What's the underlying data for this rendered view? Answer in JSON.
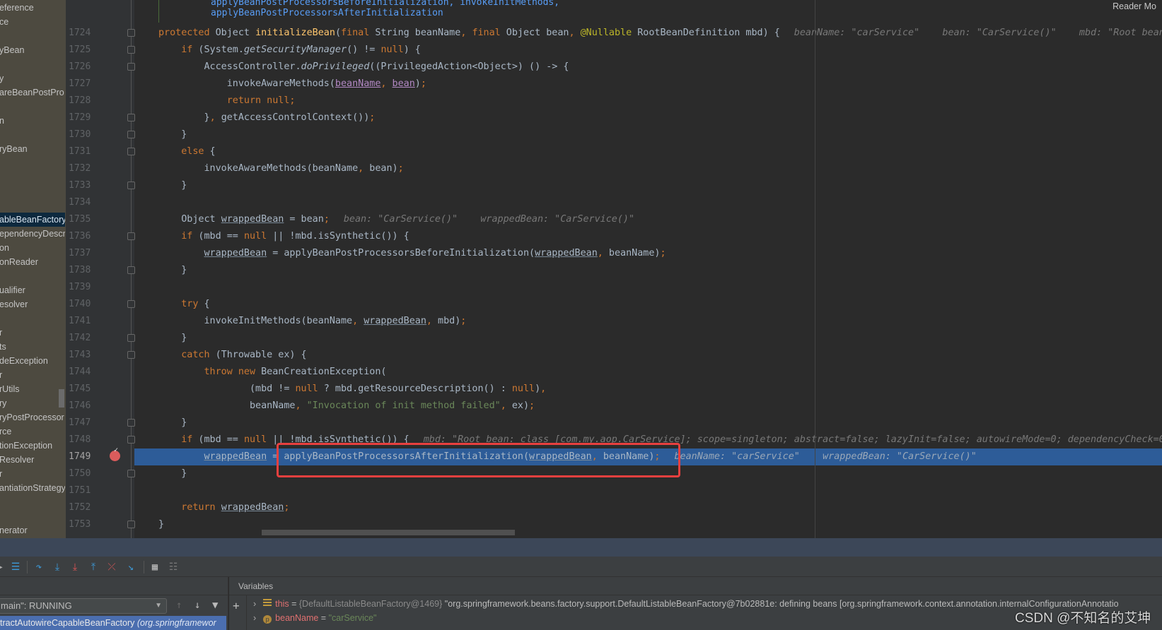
{
  "editor": {
    "reader_mode": "Reader Mo",
    "doc_lines": [
      "applyBeanPostProcessorsBeforeInitialization, invokeInitMethods,",
      "applyBeanPostProcessorsAfterInitialization"
    ],
    "current_line": 1749,
    "breakpoint_line": 1749,
    "lines": [
      {
        "n": 1724,
        "t": [
          [
            "protected",
            "k"
          ],
          [
            " Object ",
            "d"
          ],
          [
            "initializeBean",
            "m"
          ],
          [
            "(",
            "d"
          ],
          [
            "final",
            "k"
          ],
          [
            " String beanName",
            "d"
          ],
          [
            ", ",
            "k"
          ],
          [
            "final",
            "k"
          ],
          [
            " Object bean",
            "d"
          ],
          [
            ", ",
            "k"
          ],
          [
            "@Nullable",
            "a"
          ],
          [
            " RootBeanDefinition mbd) {",
            "d"
          ]
        ],
        "hint": "beanName: \"carService\"    bean: \"CarService()\"    mbd: \"Root bean: "
      },
      {
        "n": 1725,
        "t": [
          [
            "    if",
            "k"
          ],
          [
            " (System.",
            "d"
          ],
          [
            "getSecurityManager",
            "i"
          ],
          [
            "() != ",
            "d"
          ],
          [
            "null",
            "k"
          ],
          [
            ") {",
            "d"
          ]
        ]
      },
      {
        "n": 1726,
        "t": [
          [
            "        AccessController.",
            "d"
          ],
          [
            "doPrivileged",
            "i"
          ],
          [
            "((PrivilegedAction<Object>) () -> {",
            "d"
          ]
        ]
      },
      {
        "n": 1727,
        "t": [
          [
            "            invokeAwareMethods(",
            "d"
          ],
          [
            "beanName",
            "p"
          ],
          [
            ", ",
            "k"
          ],
          [
            "bean",
            "p"
          ],
          [
            ")",
            "d"
          ],
          [
            ";",
            "k"
          ]
        ]
      },
      {
        "n": 1728,
        "t": [
          [
            "            return null;",
            "k"
          ]
        ]
      },
      {
        "n": 1729,
        "t": [
          [
            "        }",
            "d"
          ],
          [
            ", ",
            "k"
          ],
          [
            "getAccessControlContext())",
            "d"
          ],
          [
            ";",
            "k"
          ]
        ]
      },
      {
        "n": 1730,
        "t": [
          [
            "    }",
            "d"
          ]
        ]
      },
      {
        "n": 1731,
        "t": [
          [
            "    else",
            "k"
          ],
          [
            " {",
            "d"
          ]
        ]
      },
      {
        "n": 1732,
        "t": [
          [
            "        invokeAwareMethods(beanName",
            "d"
          ],
          [
            ", ",
            "k"
          ],
          [
            "bean)",
            "d"
          ],
          [
            ";",
            "k"
          ]
        ]
      },
      {
        "n": 1733,
        "t": [
          [
            "    }",
            "d"
          ]
        ]
      },
      {
        "n": 1734,
        "t": []
      },
      {
        "n": 1735,
        "t": [
          [
            "    Object ",
            "d"
          ],
          [
            "wrappedBean",
            "u"
          ],
          [
            " = bean",
            "d"
          ],
          [
            ";",
            "k"
          ]
        ],
        "hint": "bean: \"CarService()\"    wrappedBean: \"CarService()\""
      },
      {
        "n": 1736,
        "t": [
          [
            "    if",
            "k"
          ],
          [
            " (mbd == ",
            "d"
          ],
          [
            "null",
            "k"
          ],
          [
            " || !mbd.isSynthetic()) {",
            "d"
          ]
        ]
      },
      {
        "n": 1737,
        "t": [
          [
            "        ",
            "d"
          ],
          [
            "wrappedBean",
            "u"
          ],
          [
            " = applyBeanPostProcessorsBeforeInitialization(",
            "d"
          ],
          [
            "wrappedBean",
            "u"
          ],
          [
            ", ",
            "k"
          ],
          [
            "beanName)",
            "d"
          ],
          [
            ";",
            "k"
          ]
        ]
      },
      {
        "n": 1738,
        "t": [
          [
            "    }",
            "d"
          ]
        ]
      },
      {
        "n": 1739,
        "t": []
      },
      {
        "n": 1740,
        "t": [
          [
            "    try",
            "k"
          ],
          [
            " {",
            "d"
          ]
        ]
      },
      {
        "n": 1741,
        "t": [
          [
            "        invokeInitMethods(beanName",
            "d"
          ],
          [
            ", ",
            "k"
          ],
          [
            "wrappedBean",
            "u"
          ],
          [
            ", ",
            "k"
          ],
          [
            "mbd)",
            "d"
          ],
          [
            ";",
            "k"
          ]
        ]
      },
      {
        "n": 1742,
        "t": [
          [
            "    }",
            "d"
          ]
        ]
      },
      {
        "n": 1743,
        "t": [
          [
            "    catch",
            "k"
          ],
          [
            " (Throwable ex) {",
            "d"
          ]
        ]
      },
      {
        "n": 1744,
        "t": [
          [
            "        throw new",
            "k"
          ],
          [
            " BeanCreationException(",
            "d"
          ]
        ]
      },
      {
        "n": 1745,
        "t": [
          [
            "                (mbd != ",
            "d"
          ],
          [
            "null",
            "k"
          ],
          [
            " ? mbd.getResourceDescription() : ",
            "d"
          ],
          [
            "null",
            "k"
          ],
          [
            ")",
            "d"
          ],
          [
            ",",
            "k"
          ]
        ]
      },
      {
        "n": 1746,
        "t": [
          [
            "                beanName",
            "d"
          ],
          [
            ", ",
            "k"
          ],
          [
            "\"Invocation of init method failed\"",
            "s"
          ],
          [
            ", ",
            "k"
          ],
          [
            "ex)",
            "d"
          ],
          [
            ";",
            "k"
          ]
        ]
      },
      {
        "n": 1747,
        "t": [
          [
            "    }",
            "d"
          ]
        ]
      },
      {
        "n": 1748,
        "t": [
          [
            "    if",
            "k"
          ],
          [
            " (mbd == ",
            "d"
          ],
          [
            "null",
            "k"
          ],
          [
            " || !mbd.isSynthetic()) {",
            "d"
          ]
        ],
        "hint": "mbd: \"Root bean: class [com.my.aop.CarService]; scope=singleton; abstract=false; lazyInit=false; autowireMode=0; dependencyCheck=0;"
      },
      {
        "n": 1749,
        "t": [
          [
            "        ",
            "d"
          ],
          [
            "wrappedBean",
            "u"
          ],
          [
            " = applyBeanPostProcessorsAfterInitialization(",
            "d"
          ],
          [
            "wrappedBean",
            "u"
          ],
          [
            ", ",
            "k"
          ],
          [
            "beanName)",
            "d"
          ],
          [
            ";",
            "k"
          ]
        ],
        "hint": "beanName: \"carService\"    wrappedBean: \"CarService()\""
      },
      {
        "n": 1750,
        "t": [
          [
            "    }",
            "d"
          ]
        ]
      },
      {
        "n": 1751,
        "t": []
      },
      {
        "n": 1752,
        "t": [
          [
            "    return",
            "k"
          ],
          [
            " ",
            "d"
          ],
          [
            "wrappedBean",
            "u"
          ],
          [
            ";",
            "k"
          ]
        ]
      },
      {
        "n": 1753,
        "t": [
          [
            "}",
            "d"
          ]
        ]
      }
    ]
  },
  "structure": {
    "items": [
      "eference",
      "ce",
      "yBean",
      "y",
      "areBeanPostPro",
      "n",
      "ryBean",
      "ableBeanFactory",
      "ependencyDescr",
      "on",
      "onReader",
      "ualifier",
      "esolver",
      "r",
      "ts",
      "deException",
      "r",
      "rUtils",
      "ry",
      "ryPostProcessor",
      "rce",
      "tionException",
      "Resolver",
      "r",
      "antiationStrategy",
      "nerator"
    ],
    "selected": "ableBeanFactory"
  },
  "debugger": {
    "thread": "main\": RUNNING",
    "frame": "tractAutowireCapableBeanFactory",
    "frame_pkg": "(org.springframewor",
    "variables_title": "Variables",
    "variables": [
      {
        "icon": "field",
        "name": "this",
        "type": "{DefaultListableBeanFactory@1469}",
        "value": "\"org.springframework.beans.factory.support.DefaultListableBeanFactory@7b02881e: defining beans [org.springframework.context.annotation.internalConfigurationAnnotatio"
      },
      {
        "icon": "param",
        "name": "beanName",
        "type": "",
        "value": "\"carService\""
      }
    ]
  },
  "watermark": "CSDN @不知名的艾坤",
  "colors": {
    "keyword": "#cc7832",
    "method": "#ffc66d",
    "string": "#6a8759",
    "highlight": "#2d5c98",
    "annotation_box": "#e8403f"
  }
}
